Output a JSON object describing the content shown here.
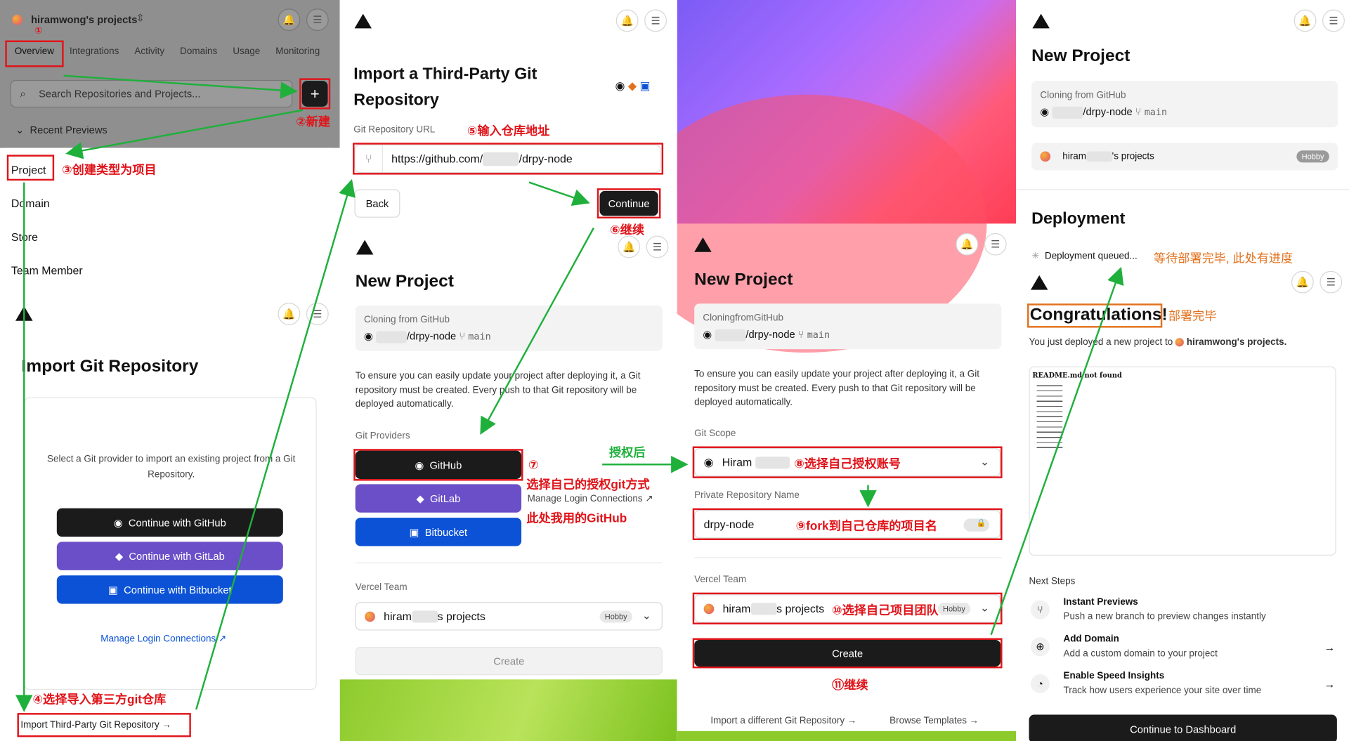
{
  "p1": {
    "team_name": "hiramwong's projects",
    "tabs": [
      "Overview",
      "Integrations",
      "Activity",
      "Domains",
      "Usage",
      "Monitoring"
    ],
    "search_placeholder": "Search Repositories and Projects...",
    "recent_previews": "Recent Previews",
    "menu": [
      "Project",
      "Domain",
      "Store",
      "Team Member"
    ],
    "import_title": "Import Git Repository",
    "import_desc": "Select a Git provider to import an existing project from a Git Repository.",
    "btn_github": "Continue with GitHub",
    "btn_gitlab": "Continue with GitLab",
    "btn_bitbucket": "Continue with Bitbucket",
    "manage_login": "Manage Login Connections",
    "import_third": "Import Third-Party Git Repository →",
    "ann_1": "①",
    "ann_2": "②新建",
    "ann_3": "③创建类型为项目",
    "ann_4": "④选择导入第三方git仓库"
  },
  "p2": {
    "title": "Import a Third-Party Git Repository",
    "url_label": "Git Repository URL",
    "url_prefix": "https://github.com/",
    "url_suffix": "/drpy-node",
    "back": "Back",
    "continue": "Continue",
    "np_title": "New Project",
    "cloning_label": "Cloning from GitHub",
    "repo": "/drpy-node",
    "branch": "main",
    "ensure_text": "To ensure you can easily update your project after deploying it, a Git repository must be created. Every push to that Git repository will be deployed automatically.",
    "providers_label": "Git Providers",
    "prov_github": "GitHub",
    "prov_gitlab": "GitLab",
    "prov_bitbucket": "Bitbucket",
    "manage_login": "Manage Login Connections",
    "team_label": "Vercel Team",
    "team_name_a": "hiram",
    "team_name_b": "s projects",
    "hobby": "Hobby",
    "create": "Create",
    "ann_5": "⑤输入仓库地址",
    "ann_6": "⑥继续",
    "ann_7": "⑦",
    "ann_7b": "选择自己的授权git方式",
    "ann_7c": "此处我用的GitHub",
    "ann_auth": "授权后"
  },
  "p3": {
    "np_title": "New Project",
    "cloning_label": "CloningfromGitHub",
    "repo": "/drpy-node",
    "branch": "main",
    "ensure_text": "To ensure you can easily update your project after deploying it, a Git repository must be created. Every push to that Git repository will be deployed automatically.",
    "scope_label": "Git Scope",
    "scope_name": "Hiram",
    "repo_name_label": "Private Repository Name",
    "repo_name": "drpy-node",
    "team_label": "Vercel Team",
    "team_name_a": "hiram",
    "team_name_b": "s projects",
    "hobby": "Hobby",
    "create": "Create",
    "import_different": "Import a different Git Repository →",
    "browse_templates": "Browse Templates →",
    "ann_8": "⑧选择自己授权账号",
    "ann_9": "⑨fork到自己仓库的项目名",
    "ann_10": "⑩选择自己项目团队",
    "ann_11": "⑪继续"
  },
  "p4": {
    "np_title": "New Project",
    "cloning_label": "Cloning from GitHub",
    "repo": "/drpy-node",
    "branch": "main",
    "team_name_a": "hiram",
    "team_name_b": "'s projects",
    "hobby": "Hobby",
    "deployment_title": "Deployment",
    "deployment_status": "Deployment queued...",
    "congrats": "Congratulations!",
    "deployed_text": "You just deployed a new project to",
    "deployed_team": "hiramwong's projects.",
    "readme_title": "README.md not found",
    "next_steps": "Next Steps",
    "steps": [
      {
        "title": "Instant Previews",
        "desc": "Push a new branch to preview changes instantly"
      },
      {
        "title": "Add Domain",
        "desc": "Add a custom domain to your project"
      },
      {
        "title": "Enable Speed Insights",
        "desc": "Track how users experience your site over time"
      }
    ],
    "continue_dashboard": "Continue to Dashboard",
    "ann_wait": "等待部署完毕, 此处有进度",
    "ann_done": "部署完毕"
  },
  "colors": {
    "annotation_red": "#e0141a",
    "arrow_green": "#1fb03c",
    "annotation_orange": "#e2711d"
  }
}
